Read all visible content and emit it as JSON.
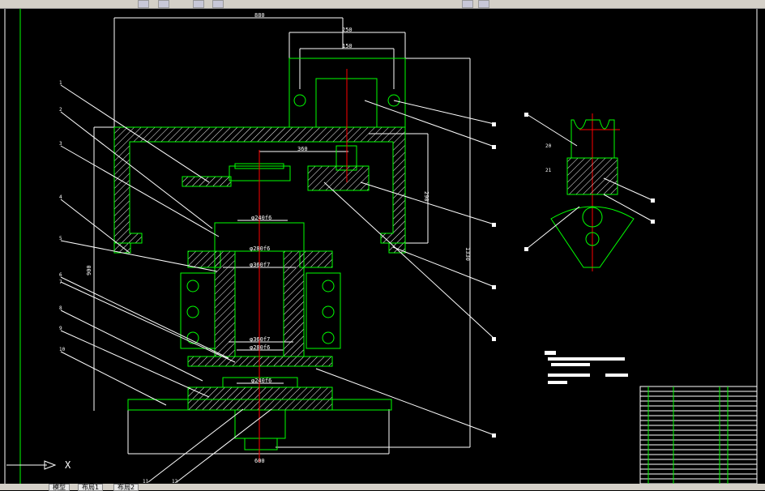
{
  "tabs": {
    "model": "模型",
    "layout1": "布局1",
    "layout2": "布局2"
  },
  "colors": {
    "background": "#000000",
    "outline": "#00ff00",
    "centerline": "#ff0000",
    "dimension": "#ffffff"
  },
  "dimensions": {
    "overall_width": "880",
    "top_block_width": "250",
    "bolt_spacing": "150",
    "arm_length": "360",
    "box_height": "290",
    "total_height": "1330",
    "column_height": "900",
    "base_width": "600",
    "d1": "φ240f6",
    "d2": "φ280f6",
    "d3": "φ360f7",
    "d4": "φ360f7",
    "d5": "φ280f6",
    "d6": "φ240f6"
  },
  "part_labels": [
    "1",
    "2",
    "3",
    "4",
    "5",
    "6",
    "7",
    "8",
    "9",
    "10",
    "11",
    "12"
  ],
  "detail_labels": [
    "20",
    "21"
  ],
  "ucs": {
    "axis_x": "X"
  }
}
